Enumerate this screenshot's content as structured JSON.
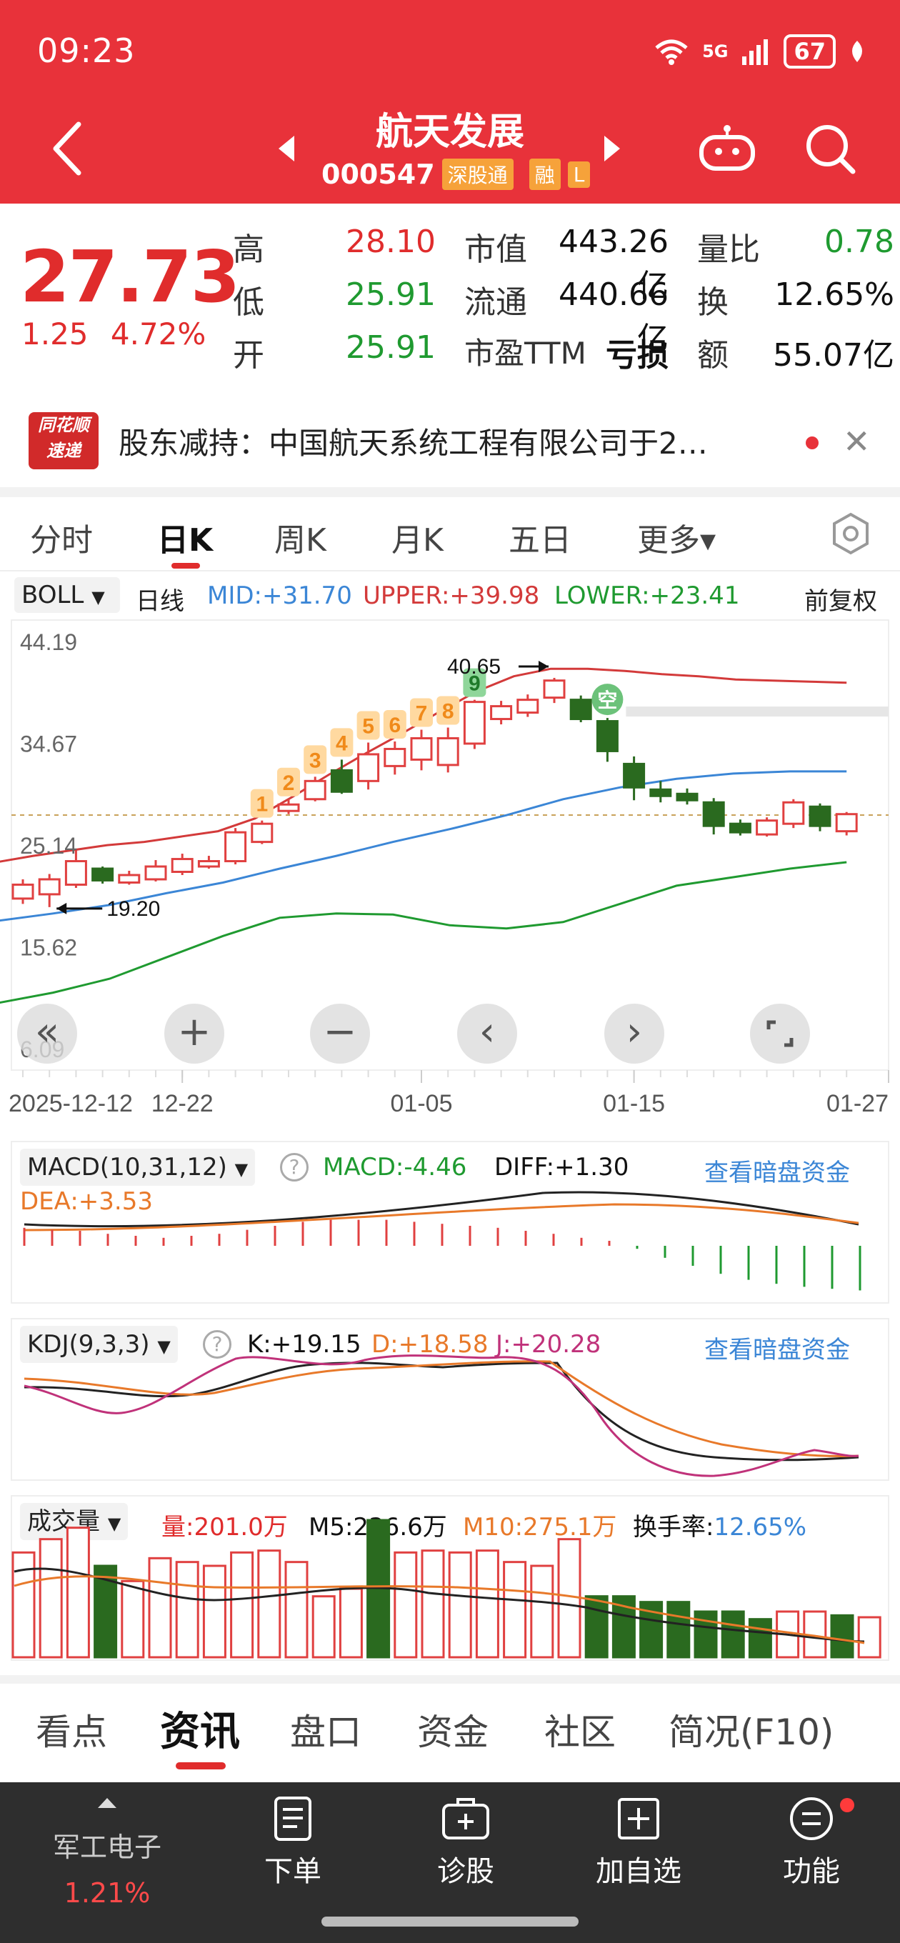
{
  "status": {
    "time": "09:23",
    "network": "5G",
    "battery": "67"
  },
  "header": {
    "stock_name": "航天发展",
    "stock_code": "000547",
    "badge_sh": "深股通",
    "badge_rong": "融",
    "badge_l": "L"
  },
  "quote": {
    "price": "27.73",
    "change": "1.25",
    "change_pct": "4.72%",
    "rows": [
      {
        "l1": "高",
        "v1": "28.10",
        "l2": "市值",
        "v2": "443.26亿",
        "l3": "量比",
        "v3": "0.78"
      },
      {
        "l1": "低",
        "v1": "25.91",
        "l2": "流通",
        "v2": "440.66亿",
        "l3": "换",
        "v3": "12.65%"
      },
      {
        "l1": "开",
        "v1": "25.91",
        "l2": "市盈TTM",
        "v2": "亏损",
        "l3": "额",
        "v3": "55.07亿"
      }
    ]
  },
  "news": {
    "logo_line1": "同花顺",
    "logo_line2": "速递",
    "text": "股东减持：中国航天系统工程有限公司于2…"
  },
  "period_tabs": [
    "分时",
    "日K",
    "周K",
    "月K",
    "五日",
    "更多▾"
  ],
  "boll": {
    "selector": "BOLL",
    "line": "日线",
    "mid": "MID:+31.70",
    "upper": "UPPER:+39.98",
    "lower": "LOWER:+23.41",
    "adjust": "前复权"
  },
  "chart_data": {
    "type": "candlestick",
    "y_ticks": [
      "44.19",
      "34.67",
      "25.14",
      "15.62",
      "6.09"
    ],
    "x_ticks": [
      "2025-12-12",
      "12-22",
      "01-05",
      "01-15",
      "01-27"
    ],
    "ylim": [
      6.09,
      44.19
    ],
    "annotations": {
      "high": "40.65",
      "low": "19.20",
      "short_signal": "空"
    },
    "td_counts": [
      "1",
      "2",
      "3",
      "4",
      "5",
      "6",
      "7",
      "8",
      "9"
    ],
    "candles": [
      {
        "o": 20.0,
        "c": 21.3,
        "h": 21.8,
        "l": 19.5
      },
      {
        "o": 20.4,
        "c": 21.8,
        "h": 22.3,
        "l": 19.2
      },
      {
        "o": 21.3,
        "c": 23.5,
        "h": 24.5,
        "l": 21.0
      },
      {
        "o": 22.8,
        "c": 21.7,
        "h": 23.0,
        "l": 21.4
      },
      {
        "o": 21.5,
        "c": 22.2,
        "h": 22.6,
        "l": 21.3
      },
      {
        "o": 21.8,
        "c": 23.0,
        "h": 23.6,
        "l": 21.6
      },
      {
        "o": 22.5,
        "c": 23.7,
        "h": 24.2,
        "l": 22.2
      },
      {
        "o": 23.0,
        "c": 23.5,
        "h": 24.0,
        "l": 22.8
      },
      {
        "o": 23.5,
        "c": 26.2,
        "h": 26.6,
        "l": 23.2
      },
      {
        "o": 25.3,
        "c": 27.0,
        "h": 27.3,
        "l": 25.1
      },
      {
        "o": 28.2,
        "c": 28.8,
        "h": 29.3,
        "l": 27.9
      },
      {
        "o": 29.3,
        "c": 31.0,
        "h": 31.4,
        "l": 29.1
      },
      {
        "o": 32.0,
        "c": 30.0,
        "h": 33.0,
        "l": 29.8
      },
      {
        "o": 31.0,
        "c": 33.5,
        "h": 34.6,
        "l": 30.2
      },
      {
        "o": 32.4,
        "c": 34.0,
        "h": 34.7,
        "l": 31.6
      },
      {
        "o": 33.0,
        "c": 35.0,
        "h": 35.8,
        "l": 32.0
      },
      {
        "o": 32.5,
        "c": 35.0,
        "h": 36.0,
        "l": 31.8
      },
      {
        "o": 34.5,
        "c": 38.4,
        "h": 38.6,
        "l": 34.0
      },
      {
        "o": 36.8,
        "c": 38.0,
        "h": 38.5,
        "l": 36.3
      },
      {
        "o": 37.4,
        "c": 38.6,
        "h": 39.1,
        "l": 37.0
      },
      {
        "o": 38.8,
        "c": 40.4,
        "h": 40.65,
        "l": 38.3
      },
      {
        "o": 38.6,
        "c": 36.8,
        "h": 39.0,
        "l": 36.5
      },
      {
        "o": 36.6,
        "c": 33.8,
        "h": 36.9,
        "l": 32.8
      },
      {
        "o": 32.6,
        "c": 30.4,
        "h": 33.3,
        "l": 29.2
      },
      {
        "o": 30.2,
        "c": 29.6,
        "h": 31.0,
        "l": 29.0
      },
      {
        "o": 29.8,
        "c": 29.2,
        "h": 30.3,
        "l": 28.8
      },
      {
        "o": 29.0,
        "c": 26.8,
        "h": 29.4,
        "l": 26.0
      },
      {
        "o": 27.0,
        "c": 26.2,
        "h": 27.4,
        "l": 25.9
      },
      {
        "o": 26.0,
        "c": 27.3,
        "h": 27.6,
        "l": 25.8
      },
      {
        "o": 27.0,
        "c": 29.0,
        "h": 29.3,
        "l": 26.6
      },
      {
        "o": 28.6,
        "c": 26.8,
        "h": 28.9,
        "l": 26.3
      },
      {
        "o": 26.3,
        "c": 27.9,
        "h": 28.1,
        "l": 25.91
      }
    ],
    "upper": [
      23.4,
      24.0,
      24.5,
      25.0,
      25.3,
      25.8,
      26.3,
      27.5,
      29.5,
      31.6,
      33.6,
      35.5,
      37.5,
      39.4,
      40.8,
      41.5,
      41.5,
      41.3,
      41.0,
      40.8,
      40.5,
      40.4,
      40.3,
      40.2
    ],
    "mid": [
      17.9,
      18.6,
      19.4,
      20.5,
      21.5,
      22.8,
      24.0,
      25.3,
      26.5,
      27.8,
      29.3,
      30.4,
      31.2,
      31.7,
      31.9,
      31.9
    ],
    "lower": [
      10.2,
      11.2,
      12.5,
      14.5,
      16.5,
      18.2,
      18.6,
      18.5,
      17.5,
      17.2,
      17.8,
      19.5,
      21.2,
      22.0,
      22.8,
      23.4
    ],
    "macd": {
      "header": "MACD(10,31,12)",
      "macd": "MACD:-4.46",
      "diff": "DIFF:+1.30",
      "dea": "DEA:+3.53",
      "hist": [
        1.8,
        1.6,
        1.5,
        1.2,
        1.0,
        0.8,
        1.0,
        1.2,
        1.6,
        2.0,
        2.4,
        2.6,
        2.6,
        2.6,
        2.4,
        2.2,
        2.0,
        1.8,
        1.5,
        1.2,
        0.8,
        0.5,
        -0.3,
        -1.2,
        -2.0,
        -2.8,
        -3.4,
        -3.8,
        -4.1,
        -4.3,
        -4.46
      ]
    },
    "kdj": {
      "header": "KDJ(9,3,3)",
      "k": "K:+19.15",
      "d": "D:+18.58",
      "j": "J:+20.28"
    },
    "volume": {
      "header": "成交量",
      "vol": "量:201.0万",
      "m5": "M5:236.6万",
      "m10": "M10:275.1万",
      "turnover_label": "换手率:",
      "turnover": "12.65%",
      "values": [
        55,
        62,
        68,
        48,
        40,
        52,
        50,
        48,
        55,
        56,
        50,
        32,
        36,
        72,
        55,
        56,
        55,
        56,
        50,
        48,
        62,
        32,
        32,
        29,
        29,
        24,
        24,
        20,
        24,
        24,
        22,
        21
      ],
      "up": [
        1,
        1,
        1,
        0,
        1,
        1,
        1,
        1,
        1,
        1,
        1,
        1,
        1,
        0,
        1,
        1,
        1,
        1,
        1,
        1,
        1,
        0,
        0,
        0,
        0,
        0,
        0,
        0,
        1,
        1,
        0,
        1
      ]
    },
    "link": "查看暗盘资金"
  },
  "zoom": {
    "back": "«",
    "zoom_in": "+",
    "zoom_out": "−",
    "left": "‹",
    "right": "›"
  },
  "info_tabs": [
    "看点",
    "资讯",
    "盘口",
    "资金",
    "社区",
    "简况(F10)"
  ],
  "bottom_nav": {
    "sector": "军工电子",
    "sector_change": "1.21%",
    "items": [
      "下单",
      "诊股",
      "加自选",
      "功能"
    ]
  }
}
